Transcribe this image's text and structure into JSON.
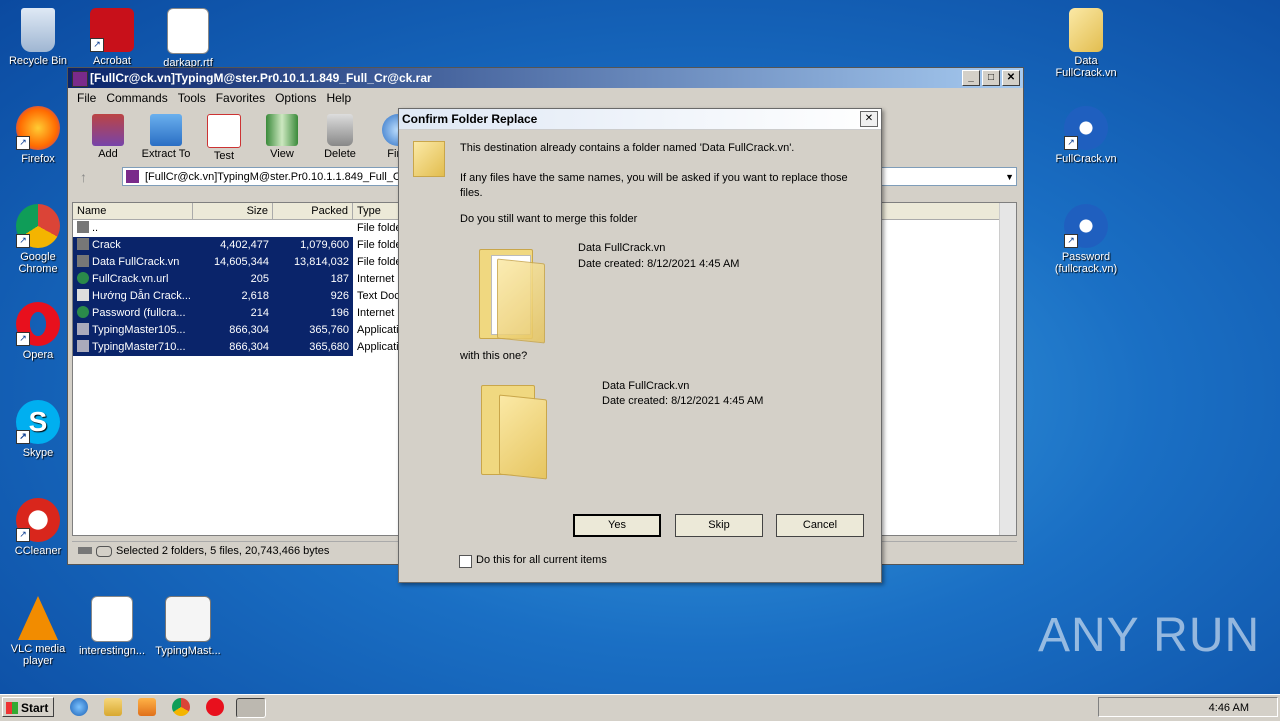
{
  "desktop": {
    "icons_left": [
      {
        "label": "Recycle Bin",
        "icon": "recycle-bin-icon"
      },
      {
        "label": "Acrobat",
        "icon": "acrobat-icon"
      },
      {
        "label": "darkapr.rtf",
        "icon": "word-doc-icon"
      },
      {
        "label": "Firefox",
        "icon": "firefox-icon"
      },
      {
        "label": "Google Chrome",
        "icon": "chrome-icon"
      },
      {
        "label": "Opera",
        "icon": "opera-icon"
      },
      {
        "label": "Skype",
        "icon": "skype-icon"
      },
      {
        "label": "CCleaner",
        "icon": "ccleaner-icon"
      },
      {
        "label": "VLC media player",
        "icon": "vlc-icon"
      },
      {
        "label": "interestingn...",
        "icon": "word-doc-icon"
      },
      {
        "label": "TypingMast...",
        "icon": "app-icon"
      }
    ],
    "icons_right": [
      {
        "label": "Data FullCrack.vn",
        "icon": "folder-icon"
      },
      {
        "label": "FullCrack.vn",
        "icon": "info-icon"
      },
      {
        "label": "Password (fullcrack.vn)",
        "icon": "info-icon"
      }
    ]
  },
  "winrar": {
    "title": "[FullCr@ck.vn]TypingM@ster.Pr0.10.1.1.849_Full_Cr@ck.rar",
    "menu": [
      "File",
      "Commands",
      "Tools",
      "Favorites",
      "Options",
      "Help"
    ],
    "toolbar": [
      "Add",
      "Extract To",
      "Test",
      "View",
      "Delete",
      "Find"
    ],
    "address": "[FullCr@ck.vn]TypingM@ster.Pr0.10.1.1.849_Full_C",
    "columns": [
      "Name",
      "Size",
      "Packed",
      "Type"
    ],
    "rows": [
      {
        "name": "..",
        "size": "",
        "packed": "",
        "type": "File folde"
      },
      {
        "name": "Crack",
        "size": "4,402,477",
        "packed": "1,079,600",
        "type": "File folde"
      },
      {
        "name": "Data FullCrack.vn",
        "size": "14,605,344",
        "packed": "13,814,032",
        "type": "File folde"
      },
      {
        "name": "FullCrack.vn.url",
        "size": "205",
        "packed": "187",
        "type": "Internet"
      },
      {
        "name": "Hướng Dẫn Crack...",
        "size": "2,618",
        "packed": "926",
        "type": "Text Doc"
      },
      {
        "name": "Password (fullcra...",
        "size": "214",
        "packed": "196",
        "type": "Internet"
      },
      {
        "name": "TypingMaster105...",
        "size": "866,304",
        "packed": "365,760",
        "type": "Applicati"
      },
      {
        "name": "TypingMaster710...",
        "size": "866,304",
        "packed": "365,680",
        "type": "Applicati"
      }
    ],
    "status": "Selected 2 folders, 5 files, 20,743,466 bytes"
  },
  "dialog": {
    "title": "Confirm Folder Replace",
    "line1": "This destination already contains a folder named 'Data FullCrack.vn'.",
    "line2": "If any files have the same names, you will be asked if you want to replace those files.",
    "line3": "Do you still want to merge this folder",
    "existing_name": "Data FullCrack.vn",
    "existing_date": "Date created: 8/12/2021 4:45 AM",
    "with_this": "with this one?",
    "new_name": "Data FullCrack.vn",
    "new_date": "Date created: 8/12/2021 4:45 AM",
    "yes": "Yes",
    "skip": "Skip",
    "cancel": "Cancel",
    "checkbox": "Do this for all current items"
  },
  "taskbar": {
    "start": "Start",
    "clock": "4:46 AM"
  },
  "watermark": "ANY RUN"
}
